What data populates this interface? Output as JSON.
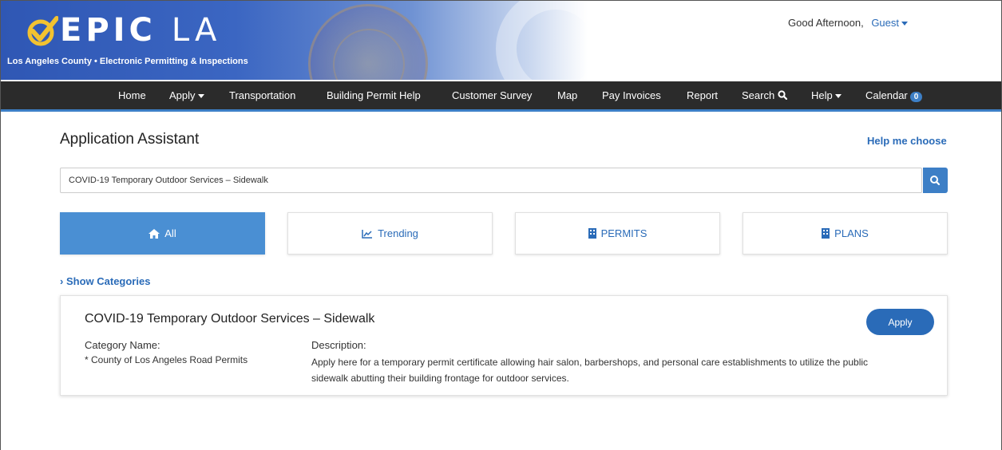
{
  "header": {
    "logo_main": "EPIC",
    "logo_suffix": "LA",
    "tagline": "Los Angeles County • Electronic Permitting & Inspections",
    "greeting": "Good Afternoon,",
    "user": "Guest"
  },
  "nav": {
    "items": [
      "Home",
      "Apply",
      "Transportation",
      "Building Permit Help",
      "Customer Survey",
      "Map",
      "Pay Invoices",
      "Report",
      "Search",
      "Help",
      "Calendar"
    ],
    "calendar_count": "0"
  },
  "main": {
    "title": "Application Assistant",
    "help_link": "Help me choose",
    "search_value": "COVID-19 Temporary Outdoor Services – Sidewalk",
    "tabs": [
      "All",
      "Trending",
      "PERMITS",
      "PLANS"
    ],
    "show_categories": "Show Categories"
  },
  "result": {
    "title": "COVID-19 Temporary Outdoor Services – Sidewalk",
    "apply_label": "Apply",
    "category_header": "Category Name:",
    "category_value": "* County of Los Angeles Road Permits",
    "description_header": "Description:",
    "description": "Apply here for a temporary permit certificate allowing hair salon, barbershops, and personal care establishments to utilize the public sidewalk abutting their building frontage for outdoor services."
  },
  "colors": {
    "accent": "#3d7fc6",
    "nav_bg": "#2b2b2b",
    "link": "#2a6bb8",
    "banner": "#2f57b4"
  },
  "icons": [
    "check-logo-icon",
    "caret-down-icon",
    "search-icon",
    "home-icon",
    "trending-icon",
    "building-icon"
  ]
}
